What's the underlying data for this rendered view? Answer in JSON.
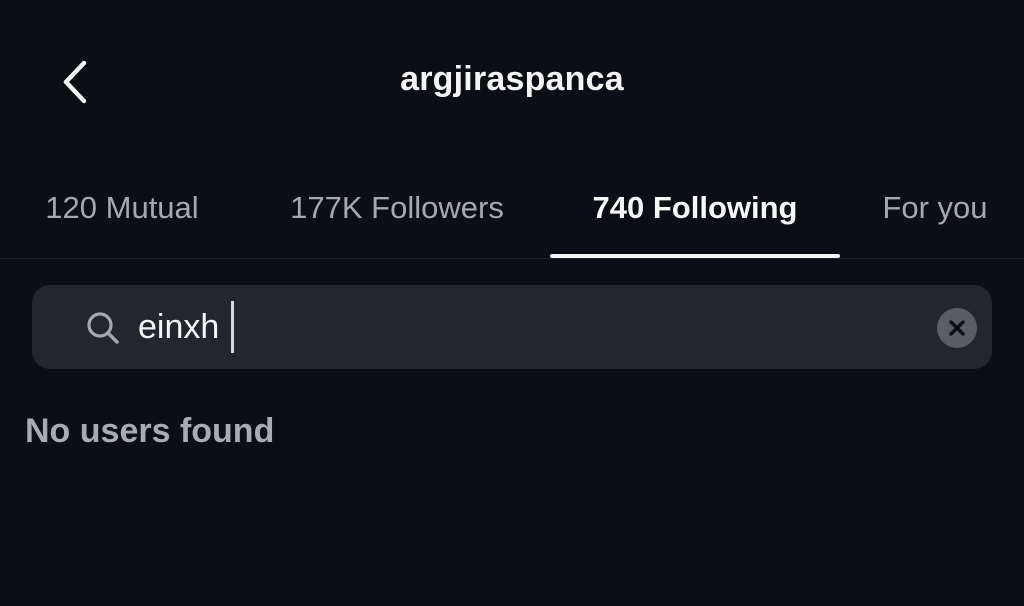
{
  "header": {
    "title": "argjiraspanca",
    "back_icon": "chevron-left-icon"
  },
  "tabs": [
    {
      "label": "120 Mutual",
      "active": false
    },
    {
      "label": "177K Followers",
      "active": false
    },
    {
      "label": "740 Following",
      "active": true
    },
    {
      "label": "For you",
      "active": false
    }
  ],
  "search": {
    "value": "einxh",
    "icon": "search-icon",
    "clear_icon": "clear-icon"
  },
  "results": {
    "empty_message": "No users found"
  },
  "colors": {
    "background": "#0c0e15",
    "search_field": "#23262d",
    "active_text": "#f7f7f7",
    "inactive_text": "#a6a8ae"
  }
}
